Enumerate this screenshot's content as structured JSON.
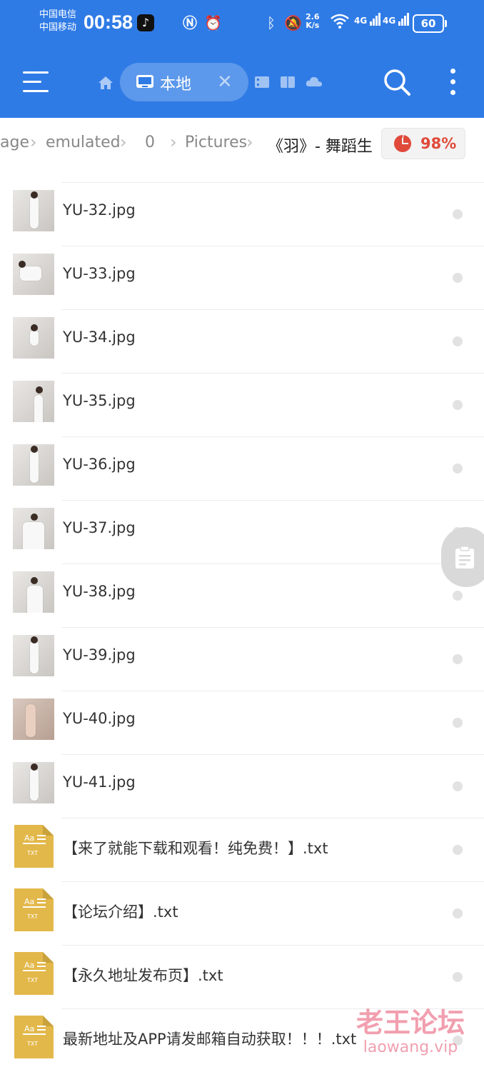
{
  "status_bar": {
    "carrier1": "中国电信",
    "carrier2": "中国移动",
    "time": "00:58",
    "net_speed_value": "2.6",
    "net_speed_unit": "K/s",
    "signal1": "4G",
    "signal2": "4G",
    "battery": "60"
  },
  "toolbar": {
    "active_tab_label": "本地",
    "icons": [
      "menu-icon",
      "home-icon",
      "phone-icon",
      "close-icon",
      "film-icon",
      "book-icon",
      "cloud-icon",
      "search-icon",
      "more-icon"
    ]
  },
  "breadcrumb": {
    "items": [
      "age",
      "emulated",
      "0",
      "Pictures",
      "《羽》- 舞蹈生"
    ],
    "usage_percent": "98%"
  },
  "files": [
    {
      "name": "YU-32.jpg",
      "type": "image"
    },
    {
      "name": "YU-33.jpg",
      "type": "image"
    },
    {
      "name": "YU-34.jpg",
      "type": "image"
    },
    {
      "name": "YU-35.jpg",
      "type": "image"
    },
    {
      "name": "YU-36.jpg",
      "type": "image"
    },
    {
      "name": "YU-37.jpg",
      "type": "image"
    },
    {
      "name": "YU-38.jpg",
      "type": "image"
    },
    {
      "name": "YU-39.jpg",
      "type": "image"
    },
    {
      "name": "YU-40.jpg",
      "type": "image"
    },
    {
      "name": "YU-41.jpg",
      "type": "image"
    },
    {
      "name": "【来了就能下载和观看！纯免费！】.txt",
      "type": "text"
    },
    {
      "name": "【论坛介绍】.txt",
      "type": "text"
    },
    {
      "name": "【永久地址发布页】.txt",
      "type": "text"
    },
    {
      "name": "最新地址及APP请发邮箱自动获取！！！.txt",
      "type": "text"
    }
  ],
  "txt_icon": {
    "top": "Aa",
    "bottom": "TXT",
    "color": "#e3b84a"
  },
  "watermark": {
    "cn": "老王论坛",
    "en": "laowang.vip"
  },
  "colors": {
    "header": "#2f7be6",
    "usage": "#e04a3a"
  }
}
